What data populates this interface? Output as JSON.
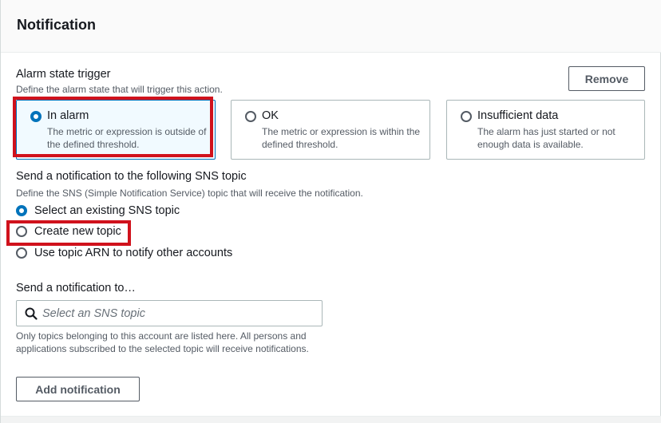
{
  "header": {
    "title": "Notification"
  },
  "alarm_trigger": {
    "label": "Alarm state trigger",
    "description": "Define the alarm state that will trigger this action.",
    "remove_label": "Remove",
    "options": [
      {
        "title": "In alarm",
        "description": "The metric or expression is outside of the defined threshold.",
        "selected": true,
        "highlighted": true
      },
      {
        "title": "OK",
        "description": "The metric or expression is within the defined threshold.",
        "selected": false,
        "highlighted": false
      },
      {
        "title": "Insufficient data",
        "description": "The alarm has just started or not enough data is available.",
        "selected": false,
        "highlighted": false
      }
    ]
  },
  "sns": {
    "label": "Send a notification to the following SNS topic",
    "description": "Define the SNS (Simple Notification Service) topic that will receive the notification.",
    "options": [
      {
        "label": "Select an existing SNS topic",
        "selected": true,
        "highlighted": false
      },
      {
        "label": "Create new topic",
        "selected": false,
        "highlighted": true
      },
      {
        "label": "Use topic ARN to notify other accounts",
        "selected": false,
        "highlighted": false
      }
    ]
  },
  "send_to": {
    "label": "Send a notification to…",
    "search_placeholder": "Select an SNS topic",
    "help": "Only topics belonging to this account are listed here. All persons and applications subscribed to the selected topic will receive notifications."
  },
  "add_notification_label": "Add notification",
  "icons": {
    "search": "search-icon"
  },
  "colors": {
    "accent": "#0073bb",
    "highlight": "#d0121c",
    "text": "#16191f",
    "muted": "#545b64"
  }
}
